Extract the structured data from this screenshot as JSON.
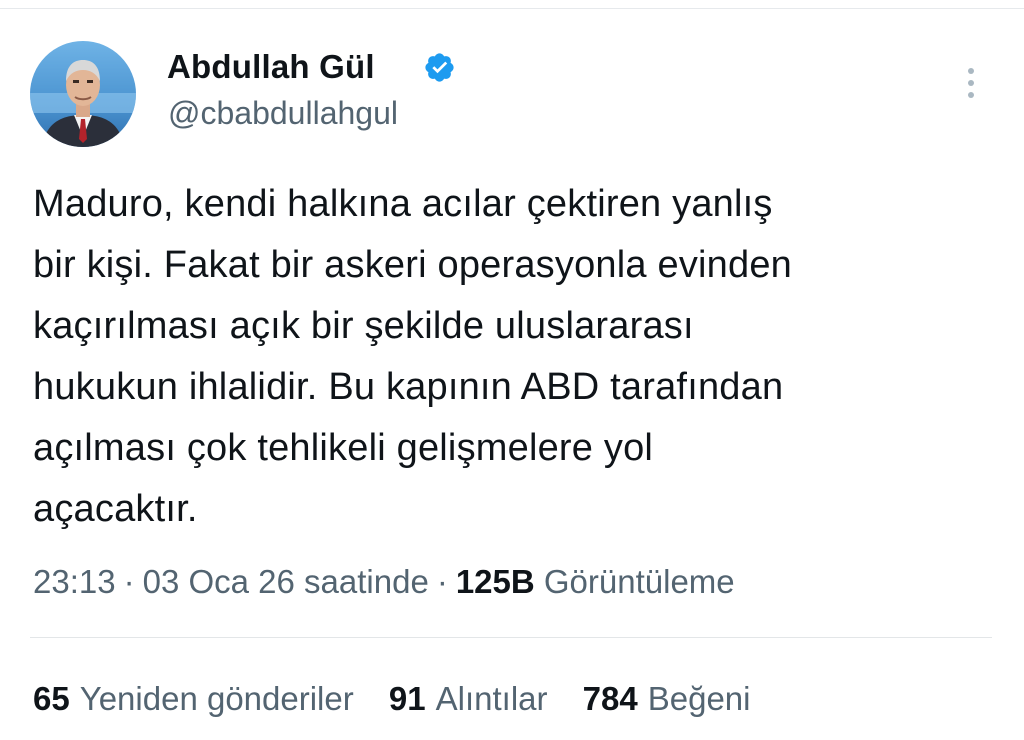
{
  "author": {
    "name": "Abdullah Gül",
    "handle": "@cbabdullahgul",
    "verified_color": "#1d9bf0"
  },
  "tweet": {
    "lines": [
      "Maduro, kendi halkına acılar çektiren yanlış",
      "bir kişi. Fakat bir askeri operasyonla evinden",
      "kaçırılması açık bir şekilde uluslararası",
      "hukukun ihlalidir. Bu kapının ABD tarafından",
      "açılması çok tehlikeli gelişmelere yol",
      "açacaktır."
    ]
  },
  "meta": {
    "time": "23:13",
    "date": "03 Oca 26 saatinde",
    "views_count": "125B",
    "views_label": "Görüntüleme"
  },
  "stats": {
    "retweets_count": "65",
    "retweets_label": "Yeniden gönderiler",
    "quotes_count": "91",
    "quotes_label": "Alıntılar",
    "likes_count": "784",
    "likes_label": "Beğeni"
  },
  "colors": {
    "text_primary": "#0f1419",
    "text_secondary": "#536471",
    "verified": "#1d9bf0"
  },
  "icons": [
    "verified-badge-icon",
    "more-options-icon"
  ]
}
